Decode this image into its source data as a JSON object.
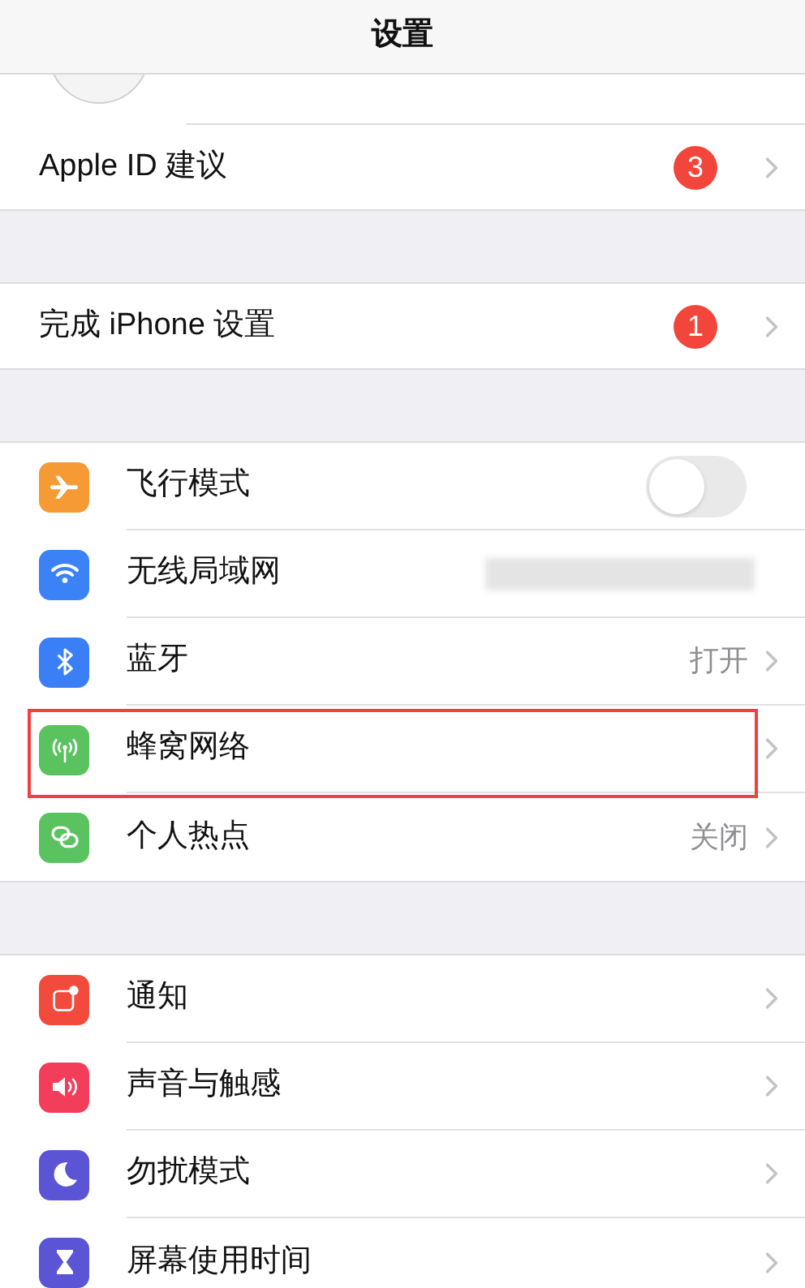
{
  "nav_bar": {
    "title": "设置"
  },
  "groups": [
    {
      "items": [
        {
          "kind": "badge",
          "label": "Apple ID 建议",
          "badge": "3",
          "highlighted": false
        }
      ]
    },
    {
      "items": [
        {
          "kind": "badge",
          "label": "完成 iPhone 设置",
          "badge": "1",
          "highlighted": false
        }
      ]
    },
    {
      "items": [
        {
          "kind": "toggle",
          "label": "飞行模式",
          "color": "#f59a35",
          "on": false,
          "highlighted": false
        },
        {
          "kind": "blurred",
          "label": "无线局域网",
          "color": "#3a82f6",
          "highlighted": false
        },
        {
          "kind": "value",
          "label": "蓝牙",
          "value": "打开",
          "color": "#3a7ff5",
          "highlighted": false
        },
        {
          "kind": "link",
          "label": "蜂窝网络",
          "color": "#5ac25f",
          "highlighted": true
        },
        {
          "kind": "value",
          "label": "个人热点",
          "value": "关闭",
          "color": "#5ac25f",
          "highlighted": false
        }
      ]
    },
    {
      "items": [
        {
          "kind": "link",
          "label": "通知",
          "color": "#f24a3c",
          "highlighted": false
        },
        {
          "kind": "link",
          "label": "声音与触感",
          "color": "#f23d5b",
          "highlighted": false
        },
        {
          "kind": "link",
          "label": "勿扰模式",
          "color": "#5b55d6",
          "highlighted": false
        },
        {
          "kind": "link",
          "label": "屏幕使用时间",
          "color": "#5b55d6",
          "highlighted": false
        }
      ]
    }
  ]
}
